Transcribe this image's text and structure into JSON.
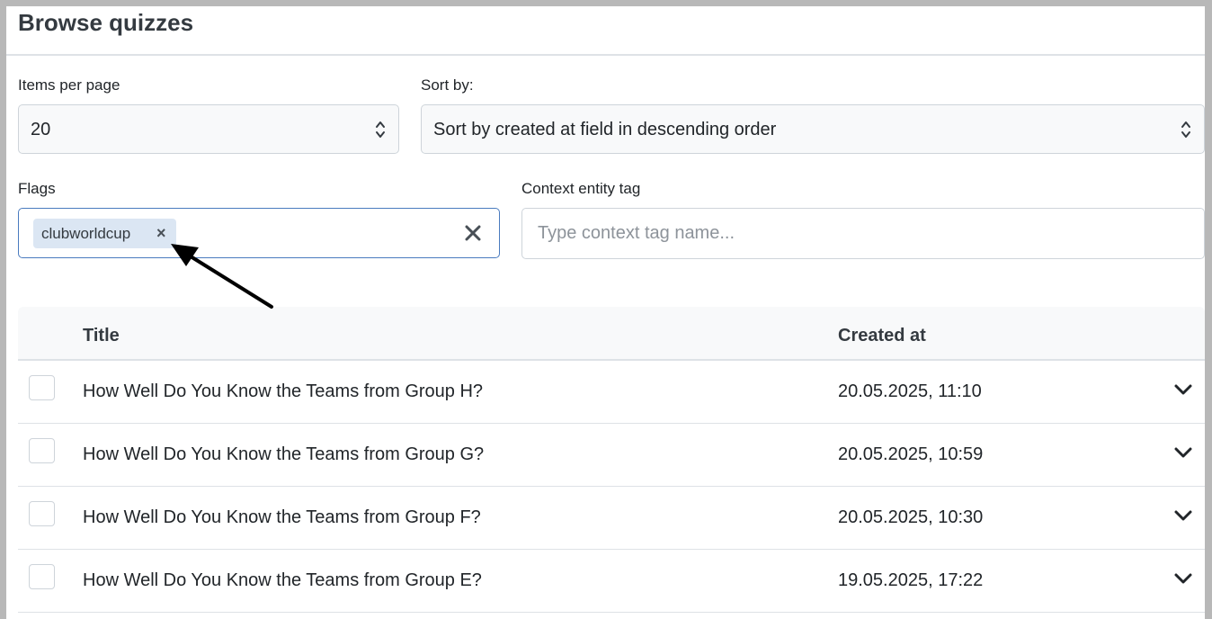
{
  "page": {
    "title": "Browse quizzes"
  },
  "filters": {
    "items_per_page": {
      "label": "Items per page",
      "value": "20"
    },
    "sort_by": {
      "label": "Sort by:",
      "value": "Sort by created at field in descending order"
    },
    "flags": {
      "label": "Flags",
      "chips": [
        "clubworldcup"
      ],
      "chip_remove_glyph": "×",
      "clear_icon": "close-icon"
    },
    "context_entity_tag": {
      "label": "Context entity tag",
      "placeholder": "Type context tag name..."
    }
  },
  "table": {
    "columns": [
      "Title",
      "Created at"
    ],
    "rows": [
      {
        "title": "How Well Do You Know the Teams from Group H?",
        "created_at": "20.05.2025, 11:10"
      },
      {
        "title": "How Well Do You Know the Teams from Group G?",
        "created_at": "20.05.2025, 10:59"
      },
      {
        "title": "How Well Do You Know the Teams from Group F?",
        "created_at": "20.05.2025, 10:30"
      },
      {
        "title": "How Well Do You Know the Teams from Group E?",
        "created_at": "19.05.2025, 17:22"
      }
    ]
  },
  "colors": {
    "accent_border": "#4a7bbf",
    "chip_bg": "#dbe6f3",
    "annotation_arrow": "#000000"
  }
}
